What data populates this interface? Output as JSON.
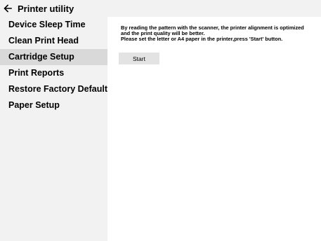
{
  "window": {
    "title": "Printer utility"
  },
  "sidebar": {
    "items": [
      {
        "label": "Device Sleep Time"
      },
      {
        "label": "Clean Print Head"
      },
      {
        "label": "Cartridge Setup"
      },
      {
        "label": "Print Reports"
      },
      {
        "label": "Restore Factory Default"
      },
      {
        "label": "Paper Setup"
      }
    ],
    "active": "Cartridge Setup"
  },
  "main": {
    "description_line1": "By reading the pattern with the scanner, the printer alignment is optimized",
    "description_line2": "and the print quality will be better.",
    "description_line3": "Please set the letter or A4  paper in the printer,press 'Start' button.",
    "start_label": "Start"
  },
  "icons": {
    "back": "back-arrow-icon"
  },
  "colors": {
    "sidebar_bg": "#f2f2f2",
    "active_item_bg": "#d9d9d9",
    "button_bg": "#e3e3e3",
    "text": "#000000"
  }
}
